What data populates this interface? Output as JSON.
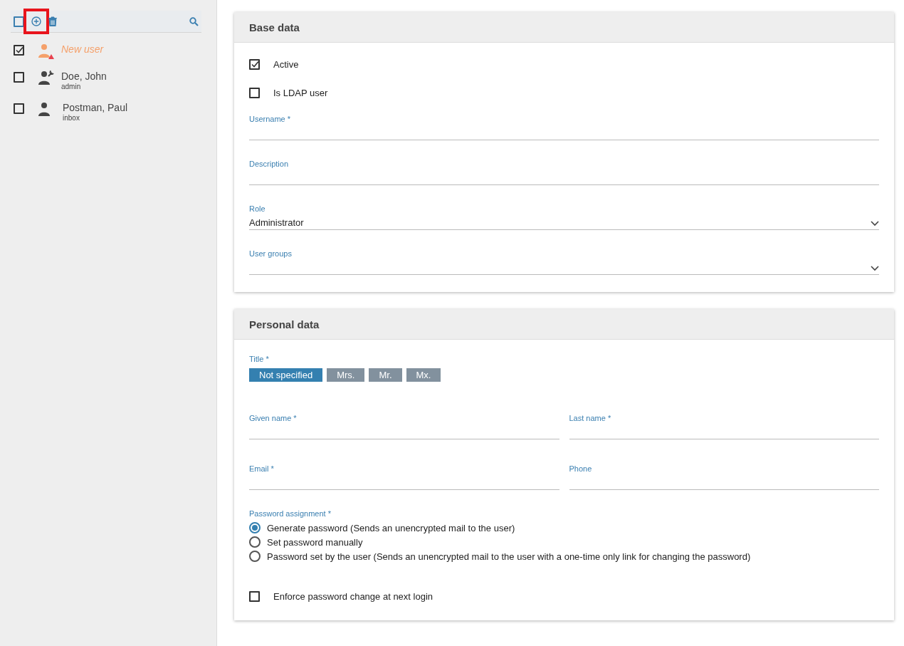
{
  "sidebar": {
    "toolbar": {
      "select_all_checked": false,
      "add_highlighted": true
    },
    "users": [
      {
        "name": "New user",
        "kind": "new",
        "checked": true
      },
      {
        "name": "Doe, John",
        "subtitle": "admin",
        "kind": "admin",
        "checked": false
      },
      {
        "name": "Postman, Paul",
        "subtitle": "inbox",
        "kind": "user",
        "checked": false
      }
    ]
  },
  "base_data": {
    "title": "Base data",
    "checkboxes": [
      {
        "label": "Active",
        "checked": true
      },
      {
        "label": "Is LDAP user",
        "checked": false
      }
    ],
    "fields": [
      {
        "kind": "text",
        "label": "Username *"
      },
      {
        "kind": "text",
        "label": "Description"
      },
      {
        "kind": "select",
        "label": "Role",
        "value": "Administrator"
      },
      {
        "kind": "select",
        "label": "User groups"
      }
    ]
  },
  "personal_data": {
    "title": "Personal data",
    "title_label": "Title *",
    "title_options": [
      {
        "label": "Not specified",
        "selected": true
      },
      {
        "label": "Mrs.",
        "selected": false
      },
      {
        "label": "Mr.",
        "selected": false
      },
      {
        "label": "Mx.",
        "selected": false
      }
    ],
    "field_rows": [
      [
        {
          "label": "Given name *"
        },
        {
          "label": "Last name *"
        }
      ],
      [
        {
          "label": "Email *"
        },
        {
          "label": "Phone"
        }
      ]
    ],
    "password_label": "Password assignment *",
    "password_options": [
      {
        "label": "Generate password (Sends an unencrypted mail to the user)",
        "selected": true
      },
      {
        "label": "Set password manually",
        "selected": false
      },
      {
        "label": "Password set by the user (Sends an unencrypted mail to the user with a one-time only link for changing the password)",
        "selected": false
      }
    ],
    "enforce": {
      "label": "Enforce password change at next login",
      "checked": false
    }
  }
}
